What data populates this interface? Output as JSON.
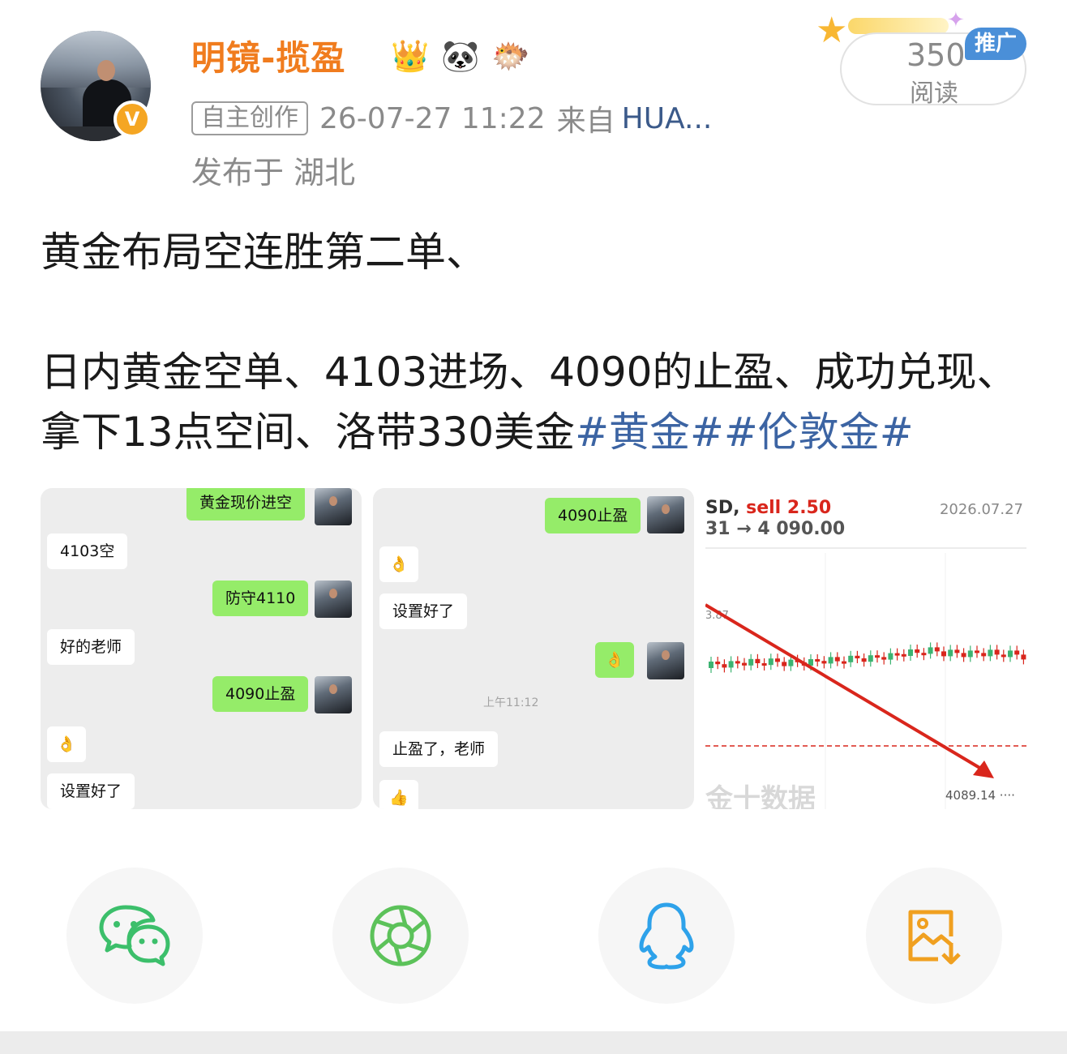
{
  "author": {
    "name": "明镜-揽盈",
    "verified_mark": "V",
    "badges": [
      {
        "icon": "crown-gem-badge-icon",
        "glyph": "👑"
      },
      {
        "icon": "panda-badge-icon",
        "glyph": "🐼"
      },
      {
        "icon": "pufferfish-badge-icon",
        "glyph": "🐡"
      }
    ]
  },
  "meta": {
    "tag": "自主创作",
    "time": "26-07-27 11:22",
    "from_label": "来自",
    "device": "HUA...",
    "location": "发布于 湖北"
  },
  "reads": {
    "count": "350",
    "label": "阅读",
    "ad_label": "推广"
  },
  "post": {
    "line1": "黄金布局空连胜第二单、",
    "line2": "日内黄金空单、4103进场、4090的止盈、成功兑现、拿下13点空间、洛带330美金",
    "hashtags": [
      "#黄金#",
      "#伦敦金#"
    ]
  },
  "images": {
    "chat1": {
      "messages": [
        {
          "side": "right",
          "text": "黄金现价进空"
        },
        {
          "side": "left",
          "text": "4103空"
        },
        {
          "side": "right",
          "text": "防守4110"
        },
        {
          "side": "left",
          "text": "好的老师"
        },
        {
          "side": "right",
          "text": "4090止盈"
        },
        {
          "side": "left",
          "text": "👌"
        },
        {
          "side": "left",
          "text": "设置好了"
        }
      ]
    },
    "chat2": {
      "messages": [
        {
          "side": "right",
          "text": "4090止盈"
        },
        {
          "side": "left",
          "text": "👌"
        },
        {
          "side": "left",
          "text": "设置好了"
        },
        {
          "side": "right",
          "text": "👌"
        },
        {
          "side": "left",
          "text": "止盈了，老师"
        },
        {
          "side": "left",
          "text": "👍"
        }
      ],
      "timestamp": "上午11:12"
    },
    "chart": {
      "header_symbol": "SD, ",
      "header_action": "sell 2.50",
      "header_prices": "31 → 4 090.00",
      "date": "2026.07.27",
      "axis_label": "3.87",
      "price_label": "4089.14 ····",
      "watermark": "金十数据",
      "colors": {
        "up": "#3cb371",
        "down": "#d9261c",
        "arrow": "#d9261c"
      }
    }
  },
  "share": [
    {
      "name": "wechat-share-button",
      "icon": "wechat-icon",
      "color": "#3cbf6b"
    },
    {
      "name": "moments-share-button",
      "icon": "moments-shutter-icon",
      "color": "#5cc25a"
    },
    {
      "name": "qq-share-button",
      "icon": "qq-penguin-icon",
      "color": "#2ea2ea"
    },
    {
      "name": "save-image-button",
      "icon": "save-image-icon",
      "color": "#f0a020"
    }
  ]
}
